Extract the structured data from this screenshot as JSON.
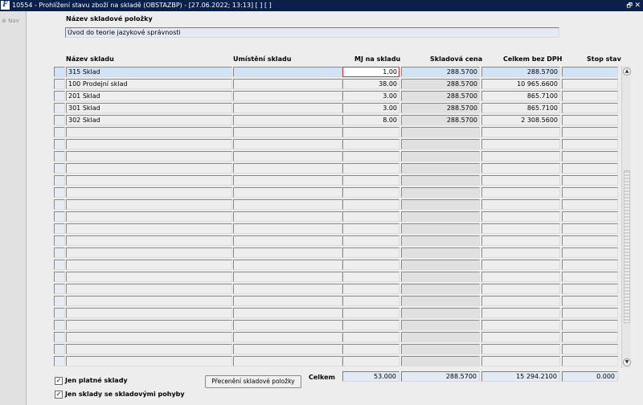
{
  "window": {
    "title": "10554 - Prohlížení stavu zboží na skladě (OBSTAZBP) - [27.06.2022; 13:13]  [ ] [ ]",
    "app_icon": "F",
    "restore_glyph": "🗗",
    "close_glyph": "✕"
  },
  "nav": {
    "label": "Nav",
    "icon": "nav-icon"
  },
  "item": {
    "label": "Název skladové položky",
    "value": "Úvod do teorie jazykové správnosti"
  },
  "columns": [
    "Název skladu",
    "Umístění skladu",
    "MJ na skladu",
    "Skladová cena",
    "Celkem bez DPH",
    "Stop stav"
  ],
  "rows": [
    {
      "name": "315 Sklad",
      "location": "",
      "qty": "1.00",
      "price": "288.5700",
      "total": "288.5700",
      "stop": ""
    },
    {
      "name": "100 Prodejní sklad",
      "location": "",
      "qty": "38.00",
      "price": "288.5700",
      "total": "10 965.6600",
      "stop": ""
    },
    {
      "name": "201 Sklad",
      "location": "",
      "qty": "3.00",
      "price": "288.5700",
      "total": "865.7100",
      "stop": ""
    },
    {
      "name": "301 Sklad",
      "location": "",
      "qty": "3.00",
      "price": "288.5700",
      "total": "865.7100",
      "stop": ""
    },
    {
      "name": "302 Sklad",
      "location": "",
      "qty": "8.00",
      "price": "288.5700",
      "total": "2 308.5600",
      "stop": ""
    }
  ],
  "checkboxes": [
    {
      "label": "Jen platné sklady",
      "checked": "✓"
    },
    {
      "label": "Jen sklady se skladovými pohyby",
      "checked": "✓"
    }
  ],
  "revalue_button": "Přecenění skladové položky",
  "totals": {
    "label": "Celkem",
    "qty": "53.000",
    "price": "288.5700",
    "total": "15 294.2100",
    "stop": "0.000"
  },
  "scroll": {
    "up": "▲",
    "down": "▼"
  }
}
